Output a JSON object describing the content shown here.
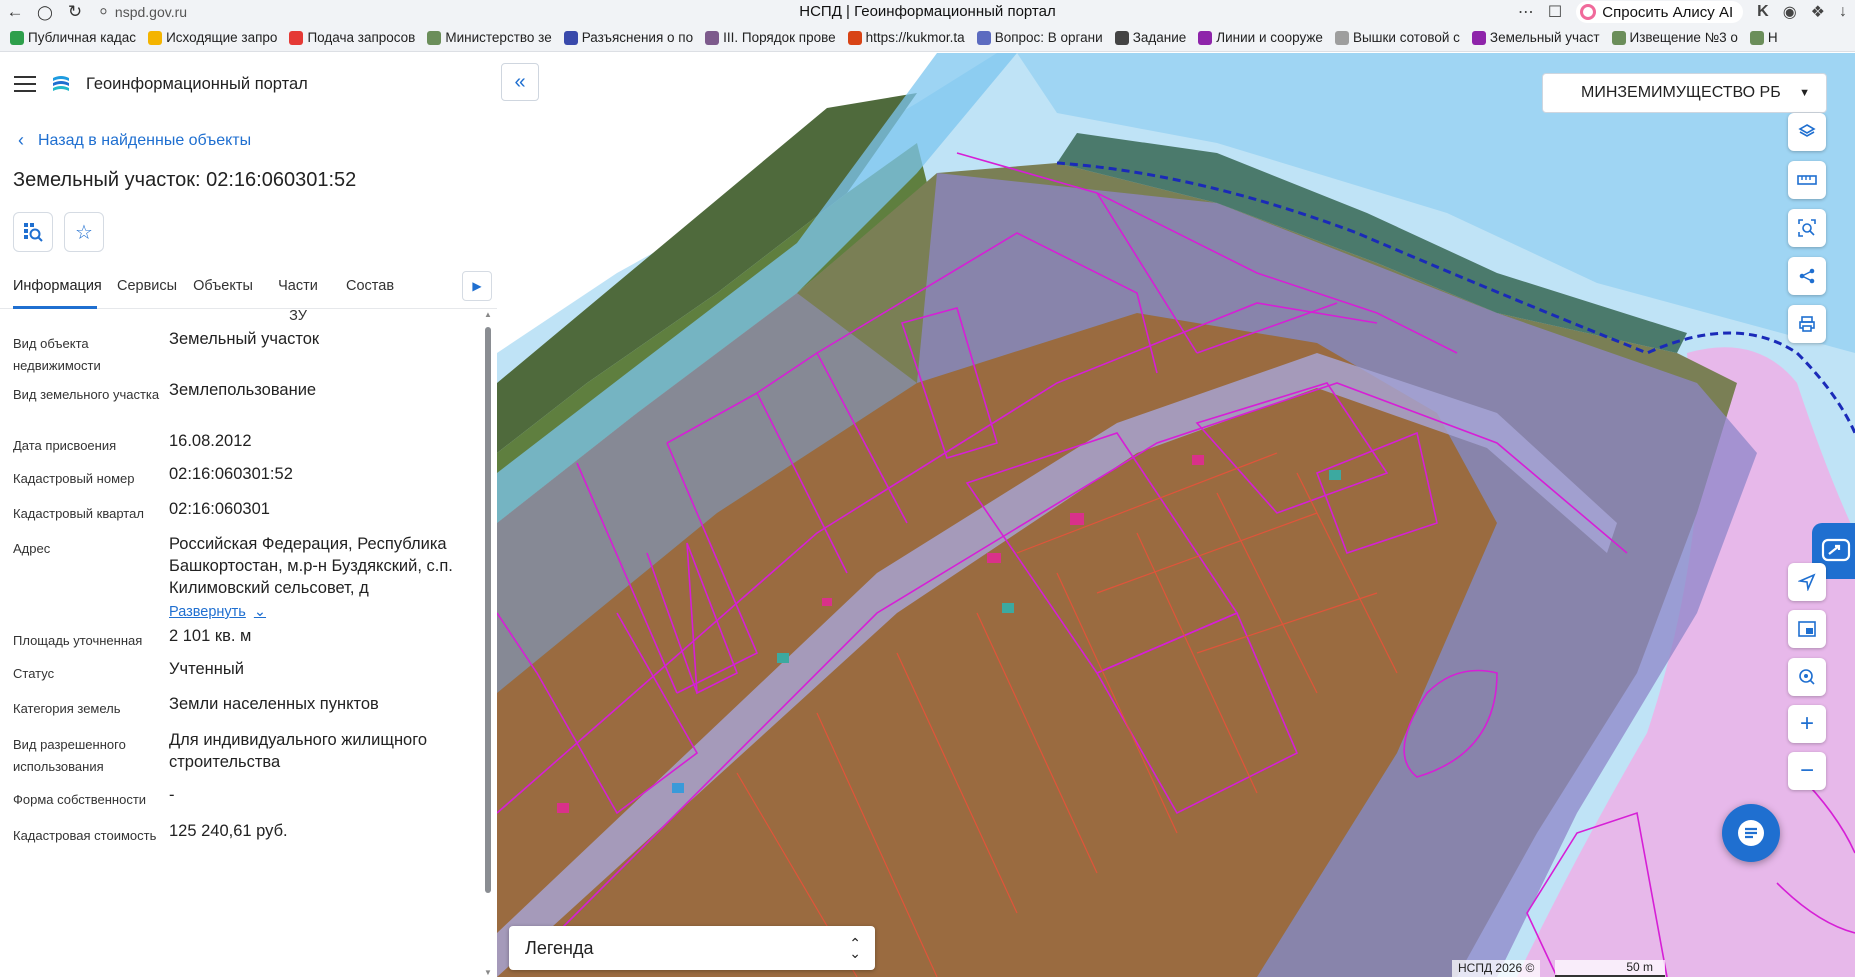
{
  "browser": {
    "url": "nspd.gov.ru",
    "title": "НСПД | Геоинформационный портал",
    "alice_label": "Спросить Алису AI",
    "bookmarks": [
      {
        "label": "Публичная кадас",
        "color": "#2e9f4b"
      },
      {
        "label": "Исходящие запро",
        "color": "#f4b400"
      },
      {
        "label": "Подача запросов",
        "color": "#e53935"
      },
      {
        "label": "Министерство зе",
        "color": "#6b8e5a"
      },
      {
        "label": "Разъяснения о по",
        "color": "#3949ab"
      },
      {
        "label": "III. Порядок прове",
        "color": "#7d5a8c"
      },
      {
        "label": "https://kukmor.ta",
        "color": "#d84315"
      },
      {
        "label": "Вопрос: В органи",
        "color": "#5c6bc0"
      },
      {
        "label": "Задание",
        "color": "#444444"
      },
      {
        "label": "Линии и сооруже",
        "color": "#8e24aa"
      },
      {
        "label": "Вышки сотовой с",
        "color": "#9e9e9e"
      },
      {
        "label": "Земельный участ",
        "color": "#8e24aa"
      },
      {
        "label": "Извещение №3 о",
        "color": "#6b8e5a"
      },
      {
        "label": "Н",
        "color": "#6b8e5a"
      }
    ]
  },
  "header": {
    "portal_title": "Геоинформационный портал",
    "back_label": "Назад в найденные объекты",
    "object_title": "Земельный участок: 02:16:060301:52"
  },
  "tabs": [
    {
      "label": "Информация",
      "active": true
    },
    {
      "label": "Сервисы",
      "active": false
    },
    {
      "label": "Объекты",
      "active": false
    },
    {
      "label": "Части ЗУ",
      "active": false
    },
    {
      "label": "Состав",
      "active": false
    }
  ],
  "properties": [
    {
      "label": "Вид объекта недвижимости",
      "value": "Земельный участок"
    },
    {
      "label": "Вид земельного участка",
      "value": "Землепользование"
    },
    {
      "label": "Дата присвоения",
      "value": "16.08.2012"
    },
    {
      "label": "Кадастровый номер",
      "value": "02:16:060301:52"
    },
    {
      "label": "Кадастровый квартал",
      "value": "02:16:060301"
    },
    {
      "label": "Адрес",
      "value": "Российская Федерация, Республика Башкортостан, м.р-н Буздякский, с.п. Килимовский сельсовет, д"
    },
    {
      "label": "Площадь уточненная",
      "value": "2 101 кв. м"
    },
    {
      "label": "Статус",
      "value": "Учтенный"
    },
    {
      "label": "Категория земель",
      "value": "Земли населенных пунктов"
    },
    {
      "label": "Вид разрешенного использования",
      "value": "Для индивидуального жилищного строительства"
    },
    {
      "label": "Форма собственности",
      "value": "-"
    },
    {
      "label": "Кадастровая стоимость",
      "value": "125 240,61 руб."
    }
  ],
  "address_expand_label": "Развернуть",
  "map": {
    "org_label": "МИНЗЕМИМУЩЕСТВО РБ",
    "legend_label": "Легенда",
    "attribution": "НСПД 2026 ©",
    "scale_label": "50 m"
  },
  "colors": {
    "accent": "#1f6fd0",
    "parcel_border": "#d61fd6",
    "water": "#7cc6ef"
  }
}
